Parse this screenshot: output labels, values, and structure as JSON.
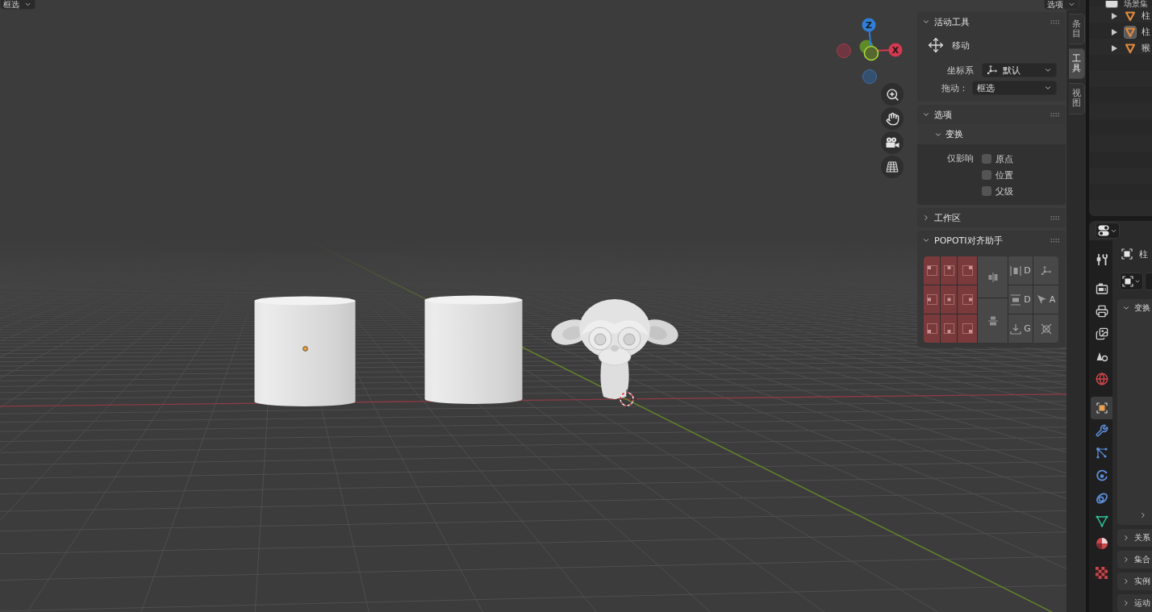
{
  "viewport": {
    "select_mode": "框选",
    "options_menu": "选项"
  },
  "gizmo": {
    "axes": [
      {
        "label": "Z",
        "color": "#2f7fd8"
      },
      {
        "label": "X",
        "color": "#d4394f"
      }
    ]
  },
  "sidebar": {
    "tabs": [
      {
        "label": "条目",
        "selected": false
      },
      {
        "label": "工具",
        "selected": true
      },
      {
        "label": "视图",
        "selected": false
      }
    ],
    "panels": [
      {
        "kind": "active_tool",
        "title": "活动工具",
        "expanded": true,
        "tool": "移动",
        "fields": [
          {
            "kind": "orientation",
            "label": "坐标系",
            "value": "默认"
          },
          {
            "kind": "plain",
            "label": "拖动：",
            "value": "框选"
          }
        ]
      },
      {
        "kind": "options",
        "title": "选项",
        "expanded": true,
        "subpanel": {
          "title": "变换",
          "expanded": true,
          "label": "仅影响",
          "checkboxes": [
            {
              "label": "原点",
              "checked": false
            },
            {
              "label": "位置",
              "checked": false
            },
            {
              "label": "父级",
              "checked": false
            }
          ]
        }
      },
      {
        "title": "工作区",
        "expanded": false
      },
      {
        "kind": "align_helper",
        "title": "POPOTI对齐助手",
        "expanded": true,
        "tool_buttons": [
          {
            "kind": "distribute_x",
            "label": "D"
          },
          {
            "kind": "orientation"
          },
          {
            "kind": "distribute_y",
            "label": "D"
          },
          {
            "kind": "cursor",
            "label": "A"
          },
          {
            "kind": "ground",
            "label": "G"
          },
          {
            "kind": "snap"
          }
        ]
      }
    ]
  },
  "outliner": {
    "root": "场景集",
    "items": [
      {
        "label": "柱",
        "expanded": false,
        "selected": false
      },
      {
        "label": "柱",
        "expanded": false,
        "selected": true
      },
      {
        "label": "猴",
        "expanded": false,
        "selected": false
      }
    ]
  },
  "properties": {
    "tab_groups": [
      {
        "tabs": [
          {
            "kind": "tool",
            "selected": false
          }
        ]
      },
      {
        "tabs": [
          {
            "kind": "render",
            "selected": false
          },
          {
            "kind": "output",
            "selected": false
          },
          {
            "kind": "view_layer",
            "selected": false
          },
          {
            "kind": "scene",
            "selected": false
          },
          {
            "kind": "world",
            "selected": false
          }
        ]
      },
      {
        "tabs": [
          {
            "kind": "object",
            "selected": true
          },
          {
            "kind": "modifiers",
            "selected": false
          },
          {
            "kind": "particles",
            "selected": false
          },
          {
            "kind": "physics",
            "selected": false
          },
          {
            "kind": "constraints",
            "selected": false
          },
          {
            "kind": "data",
            "selected": false
          },
          {
            "kind": "material",
            "selected": false
          }
        ]
      },
      {
        "tabs": [
          {
            "kind": "texture",
            "selected": false
          }
        ]
      }
    ],
    "object_name": "柱",
    "panels": [
      {
        "title": "变换",
        "expanded": true,
        "subpanels": [
          {
            "expanded": false
          }
        ]
      },
      {
        "title": "关系",
        "expanded": false
      },
      {
        "title": "集合",
        "expanded": false
      },
      {
        "title": "实例",
        "expanded": false
      },
      {
        "title": "运动",
        "expanded": false
      }
    ]
  }
}
